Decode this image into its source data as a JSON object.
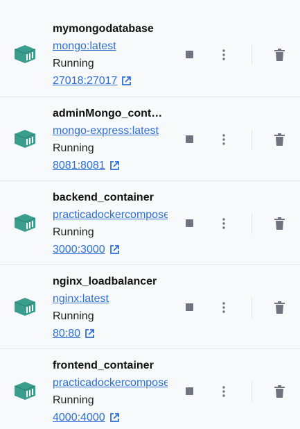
{
  "containers": [
    {
      "name": "mymongodatabase",
      "image": "mongo:latest",
      "status": "Running",
      "port": "27018:27017"
    },
    {
      "name": "adminMongo_cont…",
      "image": "mongo-express:latest",
      "status": "Running",
      "port": "8081:8081"
    },
    {
      "name": "backend_container",
      "image": "practicadockercompose",
      "status": "Running",
      "port": "3000:3000"
    },
    {
      "name": "nginx_loadbalancer",
      "image": "nginx:latest",
      "status": "Running",
      "port": "80:80"
    },
    {
      "name": "frontend_container",
      "image": "practicadockercompose",
      "status": "Running",
      "port": "4000:4000"
    }
  ],
  "colors": {
    "icon_teal": "#3a9e8f",
    "link_blue": "#2d6ed6",
    "action_gray": "#6f7380"
  },
  "icons": {
    "container": "container-cube-icon",
    "stop": "stop-icon",
    "more": "kebab-menu-icon",
    "delete": "trash-icon",
    "external": "external-link-icon"
  }
}
